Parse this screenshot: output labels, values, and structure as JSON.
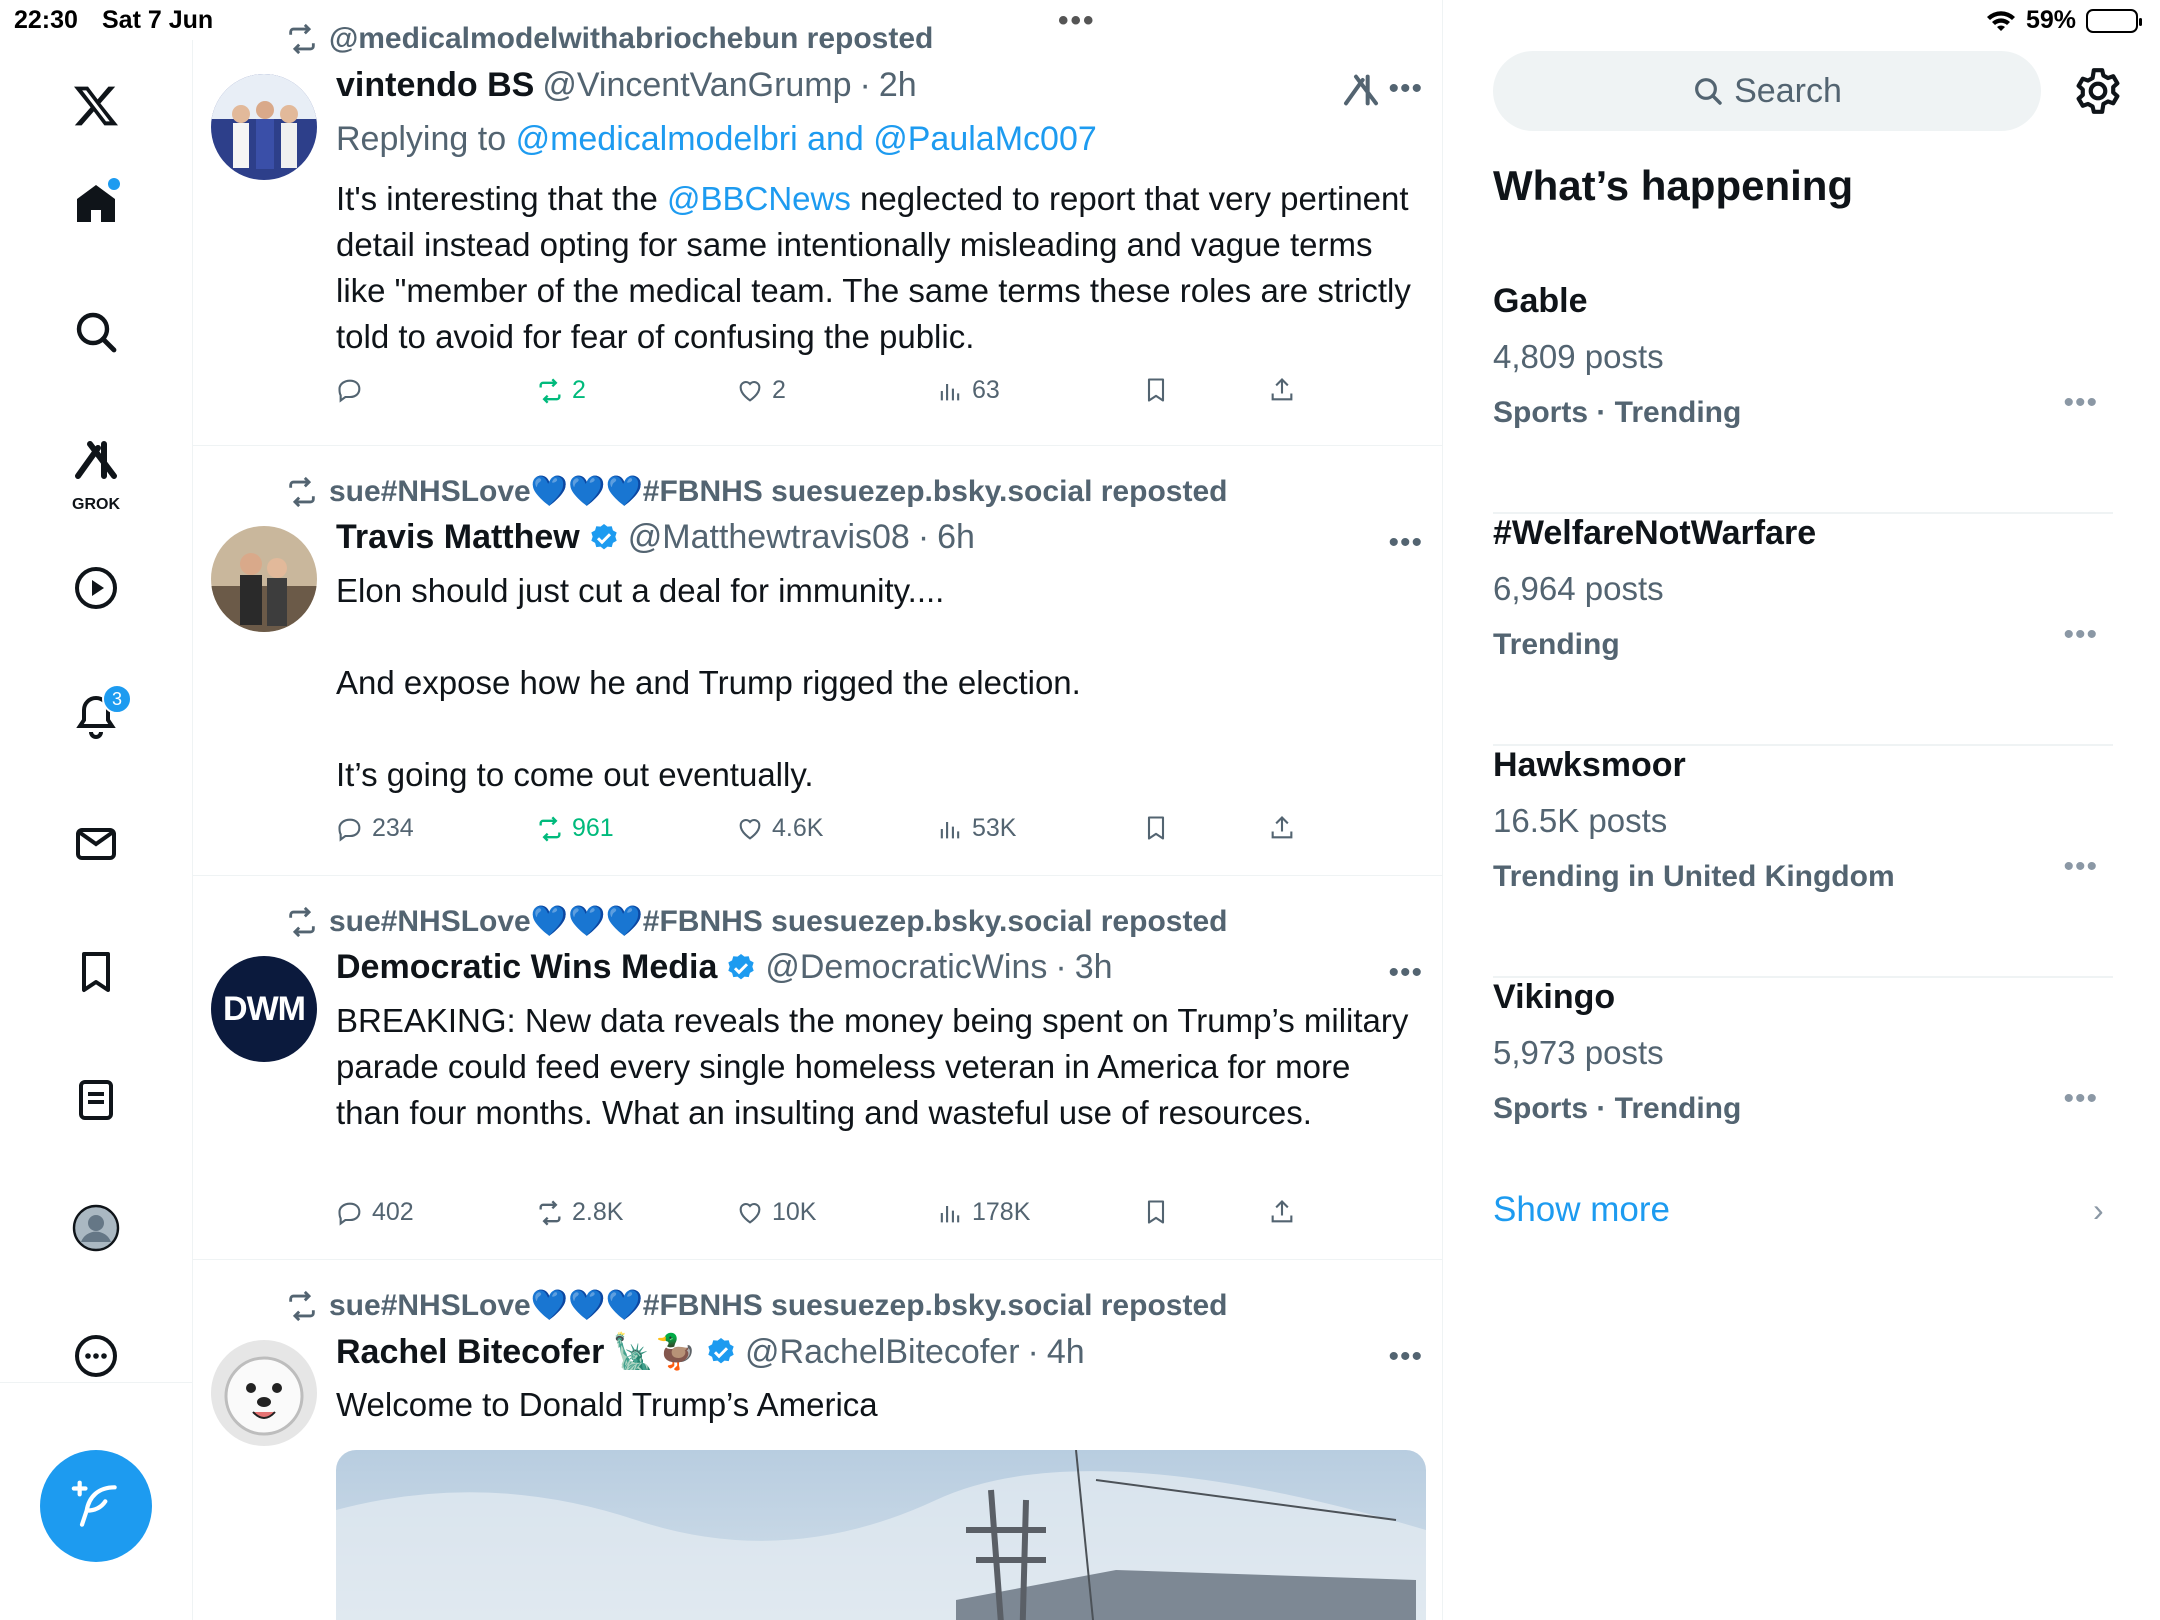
{
  "status_bar": {
    "time": "22:30",
    "date": "Sat 7 Jun",
    "battery": "59%",
    "battery_level": 0.59
  },
  "nav": {
    "grok_label": "GROK",
    "notifications_badge": "3"
  },
  "posts": [
    {
      "repost_by": "@medicalmodelwithabriochebun reposted",
      "name": "vintendo BS",
      "handle": "@VincentVanGrump",
      "sep": "·",
      "time": "2h",
      "replying_prefix": "Replying to",
      "replying_to": "@medicalmodelbri and @PaulaMc007",
      "text_before": "It's interesting that the",
      "mention": "@BBCNews",
      "text_after": "neglected to report that very pertinent detail instead opting for same intentionally misleading and vague terms like \"member of the medical team. The same terms these roles are strictly told to avoid for fear of confusing the public.",
      "replies": "",
      "reposts": "2",
      "likes": "2",
      "views": "63"
    },
    {
      "repost_by": "sue#NHSLove💙💙💙#FBNHS suesuezep.bsky.social reposted",
      "name": "Travis Matthew",
      "handle": "@Matthewtravis08",
      "sep": "·",
      "time": "6h",
      "text_line1": "Elon should just cut a deal for immunity....",
      "text_line2": "And expose how he and Trump rigged the election.",
      "text_line3": "It’s going to come out eventually.",
      "replies": "234",
      "reposts": "961",
      "likes": "4.6K",
      "views": "53K"
    },
    {
      "repost_by": "sue#NHSLove💙💙💙#FBNHS suesuezep.bsky.social reposted",
      "name": "Democratic Wins Media",
      "handle": "@DemocraticWins",
      "sep": "·",
      "time": "3h",
      "avatar_text": "DWM",
      "text": "BREAKING: New data reveals the money being spent on Trump’s military parade could feed every single homeless veteran in America for more than four months. What an insulting and wasteful use of resources.",
      "replies": "402",
      "reposts": "2.8K",
      "likes": "10K",
      "views": "178K"
    },
    {
      "repost_by": "sue#NHSLove💙💙💙#FBNHS suesuezep.bsky.social reposted",
      "name": "Rachel Bitecofer",
      "name_emoji": "🗽🦆",
      "handle": "@RachelBitecofer",
      "sep": "·",
      "time": "4h",
      "text": "Welcome to Donald Trump’s America"
    }
  ],
  "sidebar": {
    "search_placeholder": "Search",
    "title": "What’s happening",
    "trends": [
      {
        "name": "Gable",
        "posts": "4,809 posts",
        "category": "Sports · Trending"
      },
      {
        "name": "#WelfareNotWarfare",
        "posts": "6,964 posts",
        "category": "Trending"
      },
      {
        "name": "Hawksmoor",
        "posts": "16.5K posts",
        "category": "Trending in United Kingdom"
      },
      {
        "name": "Vikingo",
        "posts": "5,973 posts",
        "category": "Sports · Trending"
      }
    ],
    "show_more": "Show more"
  },
  "colors": {
    "accent": "#1d9bf0",
    "repost_green": "#00ba7c",
    "muted": "#536471"
  }
}
